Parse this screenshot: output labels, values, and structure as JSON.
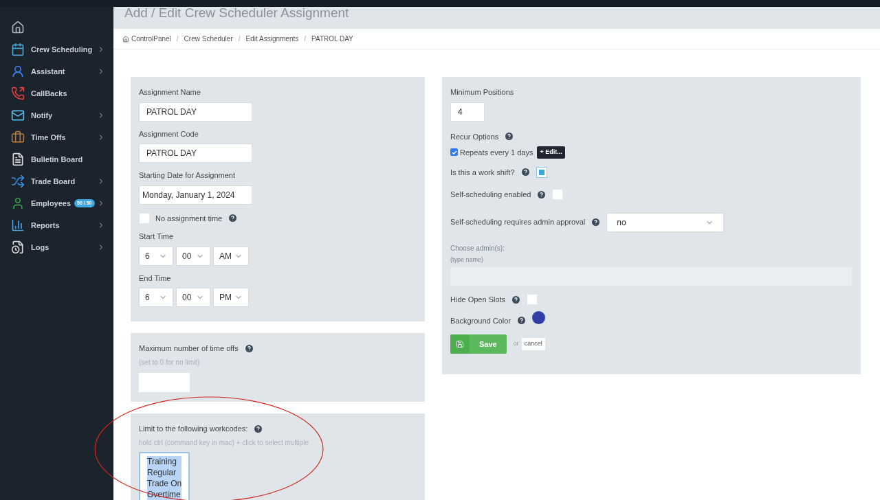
{
  "page_title": "Add / Edit Crew Scheduler Assignment",
  "sidebar": {
    "items": [
      {
        "has_submenu": false
      },
      {
        "label": "Crew Scheduling",
        "has_submenu": true
      },
      {
        "label": "Assistant",
        "has_submenu": true
      },
      {
        "label": "CallBacks",
        "has_submenu": false
      },
      {
        "label": "Notify",
        "has_submenu": true
      },
      {
        "label": "Time Offs",
        "has_submenu": true
      },
      {
        "label": "Bulletin Board",
        "has_submenu": false
      },
      {
        "label": "Trade Board",
        "has_submenu": true
      },
      {
        "label": "Employees",
        "badge": "50 / 50",
        "has_submenu": true
      },
      {
        "label": "Reports",
        "has_submenu": true
      },
      {
        "label": "Logs",
        "has_submenu": true
      }
    ]
  },
  "breadcrumb": {
    "separator": "/",
    "items": [
      "ControlPanel",
      "Crew Scheduler",
      "Edit Assignments",
      "PATROL DAY"
    ]
  },
  "left_form": {
    "assignment_name": {
      "label": "Assignment Name",
      "value": "PATROL DAY"
    },
    "assignment_code": {
      "label": "Assignment Code",
      "value": "PATROL DAY"
    },
    "starting_date": {
      "label": "Starting Date for Assignment",
      "value": "Monday, January 1, 2024"
    },
    "no_assignment_time": {
      "label": "No assignment time",
      "checked": false
    },
    "start_time": {
      "label": "Start Time",
      "hour": "6",
      "minute": "00",
      "period": "AM"
    },
    "end_time": {
      "label": "End Time",
      "hour": "6",
      "minute": "00",
      "period": "PM"
    }
  },
  "time_offs": {
    "label": "Maximum number of time offs",
    "hint": "(set to 0 for no limit)"
  },
  "workcodes": {
    "label": "Limit to the following workcodes:",
    "hint": "hold ctrl (command key in mac) + click to select multiple",
    "options": [
      {
        "label": "Training",
        "selected": true
      },
      {
        "label": "Regular",
        "selected": true
      },
      {
        "label": "Trade On",
        "selected": true
      },
      {
        "label": "Overtime",
        "selected": true
      }
    ]
  },
  "right_form": {
    "minimum_positions": {
      "label": "Minimum Positions",
      "value": "4"
    },
    "recur": {
      "label": "Recur Options",
      "checked": true,
      "text": "Repeats every 1 days",
      "edit_button": "+ Edit..."
    },
    "work_shift": {
      "label": "Is this a work shift?",
      "checked": true
    },
    "self_scheduling": {
      "label": "Self-scheduling enabled",
      "checked": false
    },
    "admin_approval": {
      "label": "Self-scheduling requires admin approval",
      "value": "no"
    },
    "choose_admins": {
      "label": "Choose admin(s):",
      "hint": "(type name)",
      "disabled": true
    },
    "hide_open_slots": {
      "label": "Hide Open Slots",
      "checked": false
    },
    "background_color": {
      "label": "Background Color",
      "color": "#2f3ea8"
    },
    "save_button": "Save",
    "or_text": "or",
    "cancel_link": "cancel"
  }
}
